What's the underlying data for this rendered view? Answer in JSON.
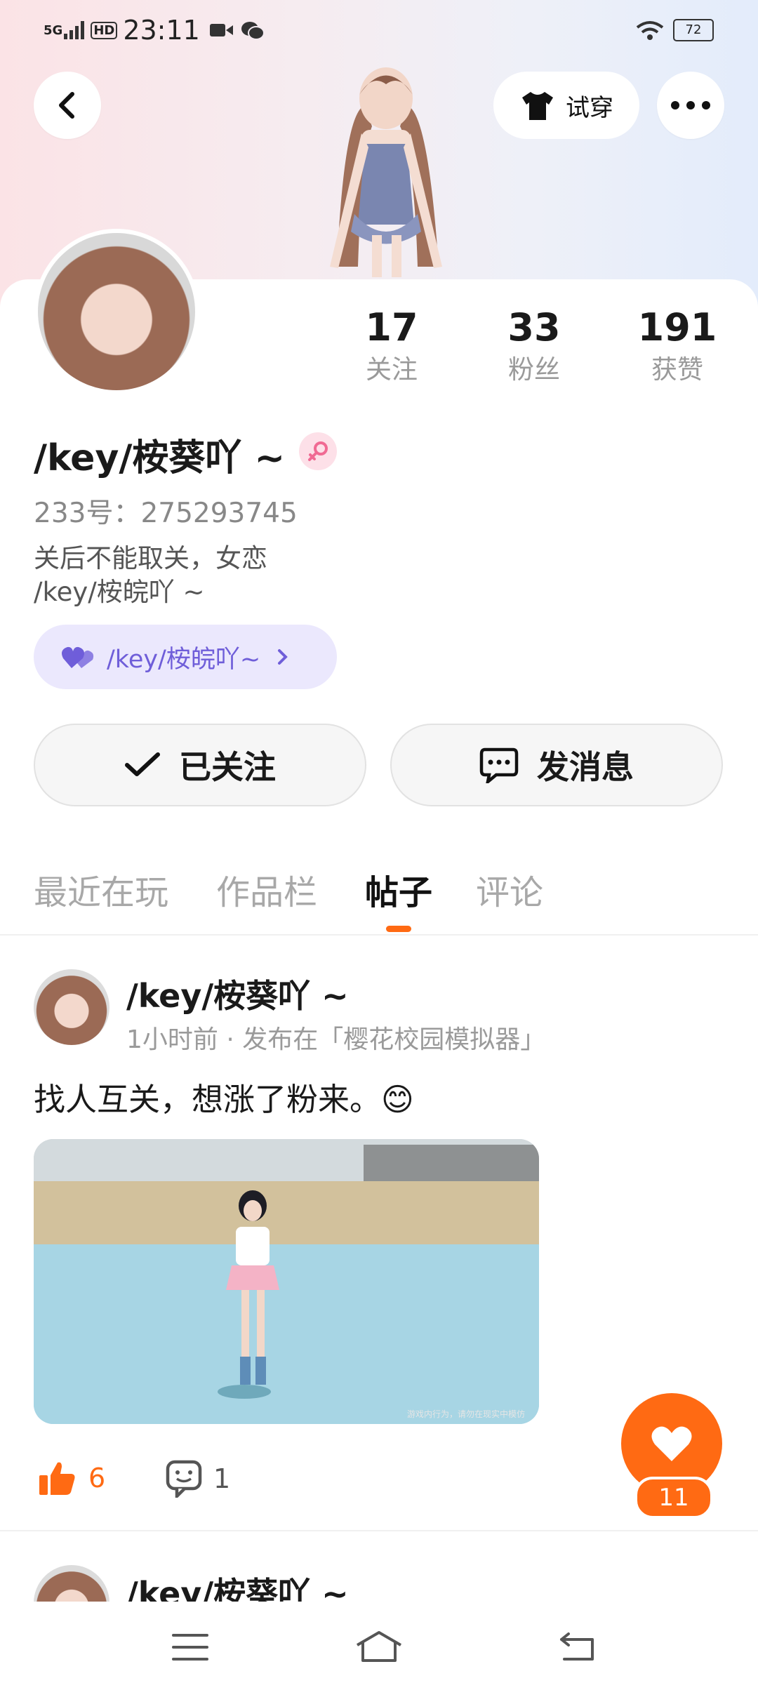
{
  "status_bar": {
    "network": "5G",
    "hd": "HD",
    "time": "23:11",
    "battery": "72"
  },
  "header": {
    "tryon_label": "试穿"
  },
  "stats": [
    {
      "value": "17",
      "label": "关注"
    },
    {
      "value": "33",
      "label": "粉丝"
    },
    {
      "value": "191",
      "label": "获赞"
    }
  ],
  "profile": {
    "username": "/key/桉葵吖 ~",
    "uid_label": "233号：275293745",
    "bio_line1": "关后不能取关，女恋",
    "bio_line2": "/key/桉皖吖 ~",
    "cp_name": "/key/桉皖吖~"
  },
  "actions": {
    "follow_label": "已关注",
    "message_label": "发消息"
  },
  "tabs": [
    "最近在玩",
    "作品栏",
    "帖子",
    "评论"
  ],
  "active_tab": 2,
  "post": {
    "author": "/key/桉葵吖 ~",
    "meta": "1小时前 · 发布在「樱花校园模拟器」",
    "text": "找人互关，想涨了粉来。😊",
    "image_watermark": "游戏内行为，请勿在现实中模仿",
    "likes": "6",
    "comments": "1"
  },
  "fab": {
    "count": "11"
  },
  "next_post": {
    "author": "/key/桉葵吖 ~"
  },
  "colors": {
    "accent": "#ff6a13",
    "cp_purple": "#6f5ed9",
    "cp_bg": "#ebe8fd"
  }
}
